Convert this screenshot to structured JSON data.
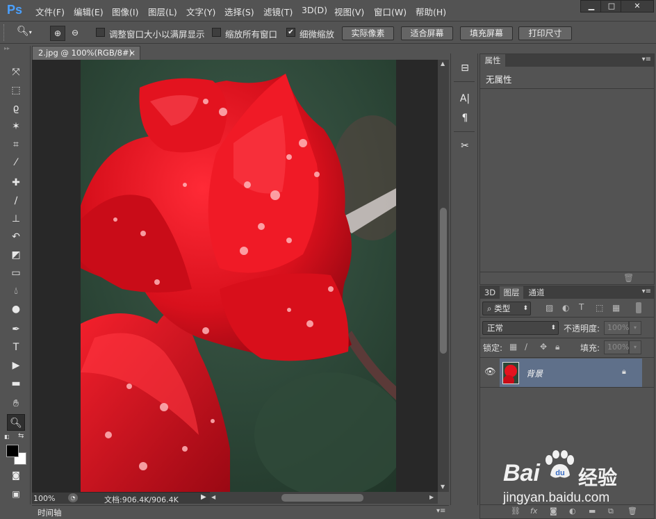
{
  "app": {
    "logo": "Ps",
    "menu": [
      "文件(F)",
      "编辑(E)",
      "图像(I)",
      "图层(L)",
      "文字(Y)",
      "选择(S)",
      "滤镜(T)",
      "3D(D)",
      "视图(V)",
      "窗口(W)",
      "帮助(H)"
    ],
    "window_buttons": [
      "minimize-icon",
      "maximize-icon",
      "close-icon"
    ]
  },
  "options": {
    "tool_icon": "zoom-icon",
    "zoom_in_icon": "zoom-in-icon",
    "zoom_out_icon": "zoom-out-icon",
    "resize_windows": {
      "label": "调整窗口大小以满屏显示",
      "checked": false
    },
    "zoom_all": {
      "label": "缩放所有窗口",
      "checked": false
    },
    "scrubby_zoom": {
      "label": "细微缩放",
      "checked": true
    },
    "buttons": [
      "实际像素",
      "适合屏幕",
      "填充屏幕",
      "打印尺寸"
    ]
  },
  "toolbox": {
    "tools": [
      "move-icon",
      "marquee-icon",
      "lasso-icon",
      "magic-wand-icon",
      "crop-icon",
      "eyedropper-icon",
      "healing-brush-icon",
      "brush-icon",
      "stamp-icon",
      "history-brush-icon",
      "eraser-icon",
      "gradient-icon",
      "blur-icon",
      "dodge-icon",
      "pen-icon",
      "type-icon",
      "path-select-icon",
      "rectangle-icon",
      "hand-icon",
      "zoom-icon"
    ],
    "active_tool": "zoom-icon",
    "fg_color": "#000000",
    "bg_color": "#ffffff"
  },
  "document": {
    "tab_title": "2.jpg @ 100%(RGB/8#)",
    "zoom": "100%",
    "doc_info": "文档:906.4K/906.4K"
  },
  "timeline": {
    "label": "时间轴"
  },
  "properties": {
    "tab": "属性",
    "content": "无属性"
  },
  "layers": {
    "tabs": [
      "3D",
      "图层",
      "通道"
    ],
    "active_tab": "图层",
    "filter_type": "类型",
    "blend_mode": "正常",
    "opacity_label": "不透明度:",
    "opacity_value": "100%",
    "lock_label": "锁定:",
    "fill_label": "填充:",
    "fill_value": "100%",
    "items": [
      {
        "name": "背景",
        "visible": true,
        "locked": true
      }
    ],
    "footer_icons": [
      "link-icon",
      "fx-icon",
      "mask-icon",
      "adjustment-icon",
      "folder-icon",
      "new-layer-icon",
      "trash-icon"
    ]
  },
  "watermark": {
    "brand_left": "Bai",
    "brand_right": "经验",
    "url": "jingyan.baidu.com"
  }
}
